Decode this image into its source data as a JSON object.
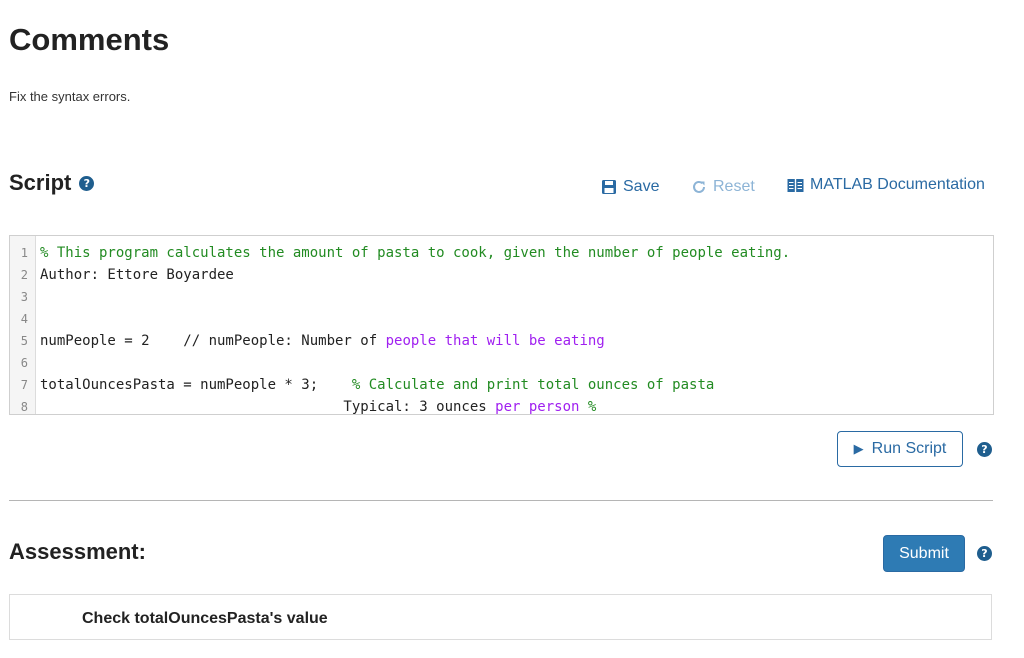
{
  "page": {
    "title": "Comments",
    "instructions": "Fix the syntax errors."
  },
  "script": {
    "heading": "Script",
    "help_glyph": "?",
    "save_label": "Save",
    "reset_label": "Reset",
    "docs_label": "MATLAB Documentation",
    "icons": {
      "save": "floppy-disk-icon",
      "reset": "refresh-icon",
      "docs": "book-icon",
      "help": "question-circle-icon"
    }
  },
  "editor": {
    "lines": [
      {
        "num": "1",
        "segments": [
          {
            "text": "% This program calculates the amount of pasta to cook, given the number of people eating.",
            "kind": "comment"
          }
        ]
      },
      {
        "num": "2",
        "segments": [
          {
            "text": "Author: Ettore Boyardee",
            "kind": "code"
          }
        ]
      },
      {
        "num": "3",
        "segments": []
      },
      {
        "num": "4",
        "segments": []
      },
      {
        "num": "5",
        "segments": [
          {
            "text": "numPeople = 2    // numPeople: Number ",
            "kind": "code"
          },
          {
            "text": "of",
            "kind": "code"
          },
          {
            "text": " people that will be eating",
            "kind": "keyword"
          }
        ]
      },
      {
        "num": "6",
        "segments": []
      },
      {
        "num": "7",
        "segments": [
          {
            "text": "totalOuncesPasta = numPeople * 3;    ",
            "kind": "code"
          },
          {
            "text": "% Calculate and print total ounces of pasta",
            "kind": "comment"
          }
        ]
      },
      {
        "num": "8",
        "segments": [
          {
            "text": "                                    Typical: 3 ounces ",
            "kind": "code"
          },
          {
            "text": "per person",
            "kind": "keyword"
          },
          {
            "text": " %",
            "kind": "comment"
          }
        ]
      }
    ]
  },
  "actions": {
    "run_label": "Run Script",
    "submit_label": "Submit"
  },
  "assessment": {
    "heading": "Assessment:",
    "checks": [
      "Check totalOuncesPasta's value"
    ]
  },
  "colors": {
    "accent": "#2a6aa3",
    "submit_bg": "#2e7bb4",
    "comment": "#228b22",
    "keyword": "#a020f0"
  }
}
